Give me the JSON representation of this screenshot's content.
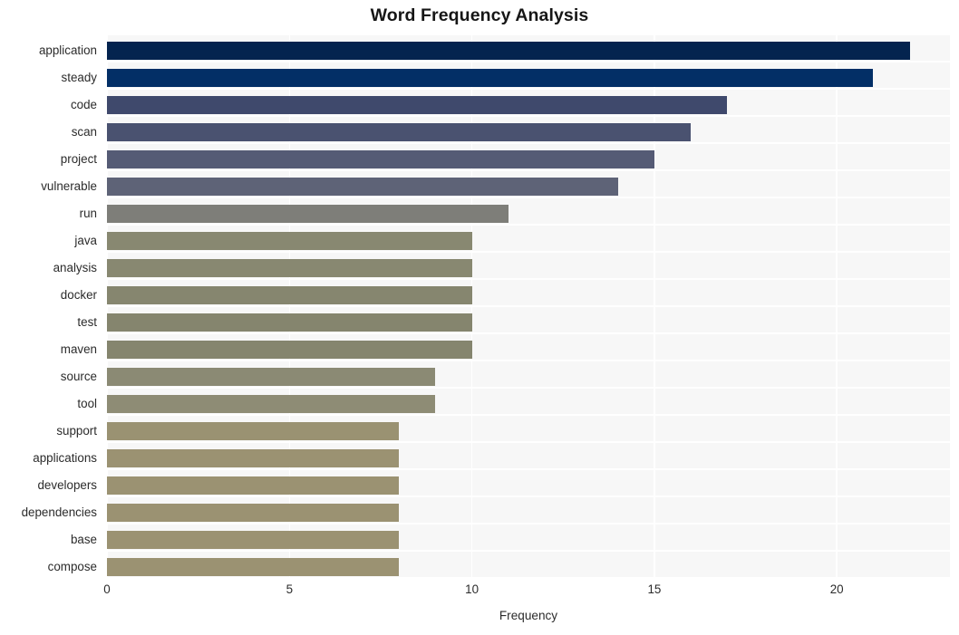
{
  "chart_data": {
    "type": "bar",
    "orientation": "horizontal",
    "title": "Word Frequency Analysis",
    "xlabel": "Frequency",
    "ylabel": "",
    "categories": [
      "application",
      "steady",
      "code",
      "scan",
      "project",
      "vulnerable",
      "run",
      "java",
      "analysis",
      "docker",
      "test",
      "maven",
      "source",
      "tool",
      "support",
      "applications",
      "developers",
      "dependencies",
      "base",
      "compose"
    ],
    "values": [
      22,
      21,
      17,
      16,
      15,
      14,
      11,
      10,
      10,
      10,
      10,
      10,
      9,
      9,
      8,
      8,
      8,
      8,
      8,
      8
    ],
    "bar_colors": [
      "#04244f",
      "#032f66",
      "#3f496c",
      "#4a5270",
      "#555b75",
      "#5e6377",
      "#7e7e79",
      "#888871",
      "#888871",
      "#86866f",
      "#85856e",
      "#85856e",
      "#8b8a74",
      "#8e8c75",
      "#9a9272",
      "#9b9272",
      "#9b9272",
      "#9b9272",
      "#9b9272",
      "#9b9272"
    ],
    "xticks": [
      0,
      5,
      10,
      15,
      20
    ],
    "xtick_labels": [
      "0",
      "5",
      "10",
      "15",
      "20"
    ],
    "xlim": [
      0,
      23.1
    ],
    "grid": true,
    "grid_color": "#ffffff",
    "plot_background": "#f7f7f7",
    "figure_background": "#ffffff",
    "legend": null
  }
}
